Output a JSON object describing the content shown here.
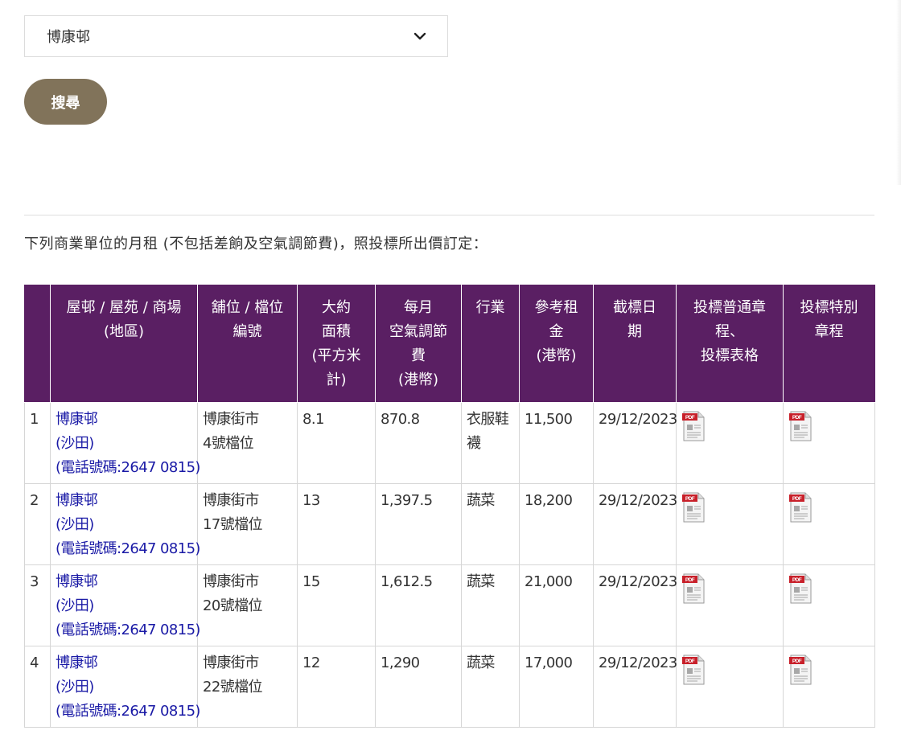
{
  "search": {
    "estate_selected": "博康邨",
    "button_label": "搜尋"
  },
  "intro_text": "下列商業單位的月租 (不包括差餉及空氣調節費)，照投標所出價訂定：",
  "table": {
    "headers": [
      "",
      "屋邨 / 屋苑 / 商場\n(地區)",
      "舖位 / 檔位\n編號",
      "大約\n面積\n(平方米\n計)",
      "每月\n空氣調節\n費\n(港幣)",
      "行業",
      "參考租\n金\n(港幣)",
      "截標日\n期",
      "投標普通章\n程、\n投標表格",
      "投標特別\n章程"
    ],
    "rows": [
      {
        "no": "1",
        "estate": "博康邨",
        "district": "(沙田)",
        "phone": "(電話號碼:2647 0815)",
        "unit": "博康街市\n4號檔位",
        "area": "8.1",
        "ac_fee": "870.8",
        "trade": "衣服鞋\n襪",
        "rent": "11,500",
        "closing_date": "29/12/2023"
      },
      {
        "no": "2",
        "estate": "博康邨",
        "district": "(沙田)",
        "phone": "(電話號碼:2647 0815)",
        "unit": "博康街市\n17號檔位",
        "area": "13",
        "ac_fee": "1,397.5",
        "trade": "蔬菜",
        "rent": "18,200",
        "closing_date": "29/12/2023"
      },
      {
        "no": "3",
        "estate": "博康邨",
        "district": "(沙田)",
        "phone": "(電話號碼:2647 0815)",
        "unit": "博康街市\n20號檔位",
        "area": "15",
        "ac_fee": "1,612.5",
        "trade": "蔬菜",
        "rent": "21,000",
        "closing_date": "29/12/2023"
      },
      {
        "no": "4",
        "estate": "博康邨",
        "district": "(沙田)",
        "phone": "(電話號碼:2647 0815)",
        "unit": "博康街市\n22號檔位",
        "area": "12",
        "ac_fee": "1,290",
        "trade": "蔬菜",
        "rent": "17,000",
        "closing_date": "29/12/2023"
      }
    ]
  },
  "colors": {
    "header_bg": "#5a1f63",
    "button_bg": "#81735a",
    "link": "#1a1aa6"
  },
  "icons": {
    "pdf": "pdf-file-icon",
    "dropdown": "chevron-down-icon"
  }
}
